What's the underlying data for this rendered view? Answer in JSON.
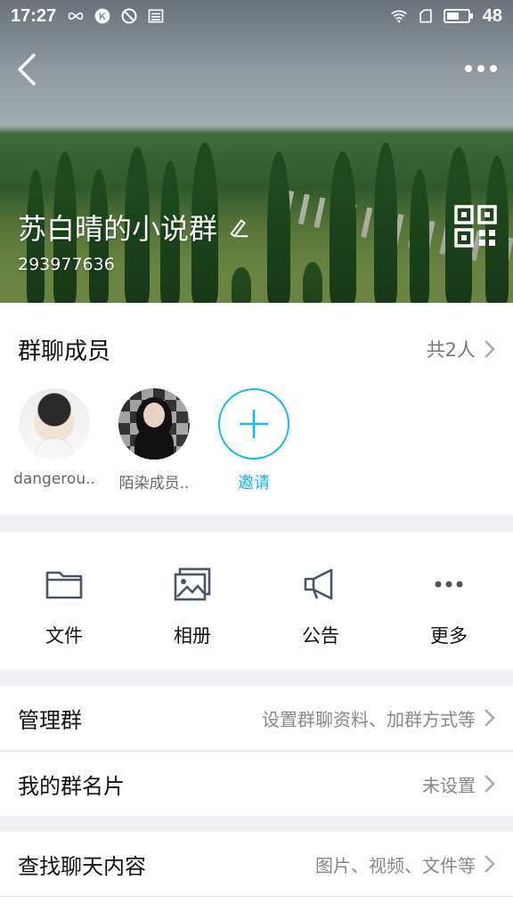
{
  "status": {
    "time": "17:27",
    "battery": "48"
  },
  "group": {
    "name": "苏白晴的小说群",
    "id": "293977636"
  },
  "members": {
    "title": "群聊成员",
    "count": "共2人",
    "list": [
      {
        "name": "dangerou.."
      },
      {
        "name": "陌染成员.."
      }
    ],
    "invite_label": "邀请"
  },
  "tools": [
    {
      "label": "文件",
      "icon": "folder-icon"
    },
    {
      "label": "相册",
      "icon": "album-icon"
    },
    {
      "label": "公告",
      "icon": "megaphone-icon"
    },
    {
      "label": "更多",
      "icon": "more-dots-icon"
    }
  ],
  "settings": [
    {
      "label": "管理群",
      "value": "设置群聊资料、加群方式等"
    },
    {
      "label": "我的群名片",
      "value": "未设置"
    },
    {
      "label": "查找聊天内容",
      "value": "图片、视频、文件等"
    }
  ],
  "colors": {
    "accent": "#12b7f5",
    "background": "#efeff4"
  }
}
